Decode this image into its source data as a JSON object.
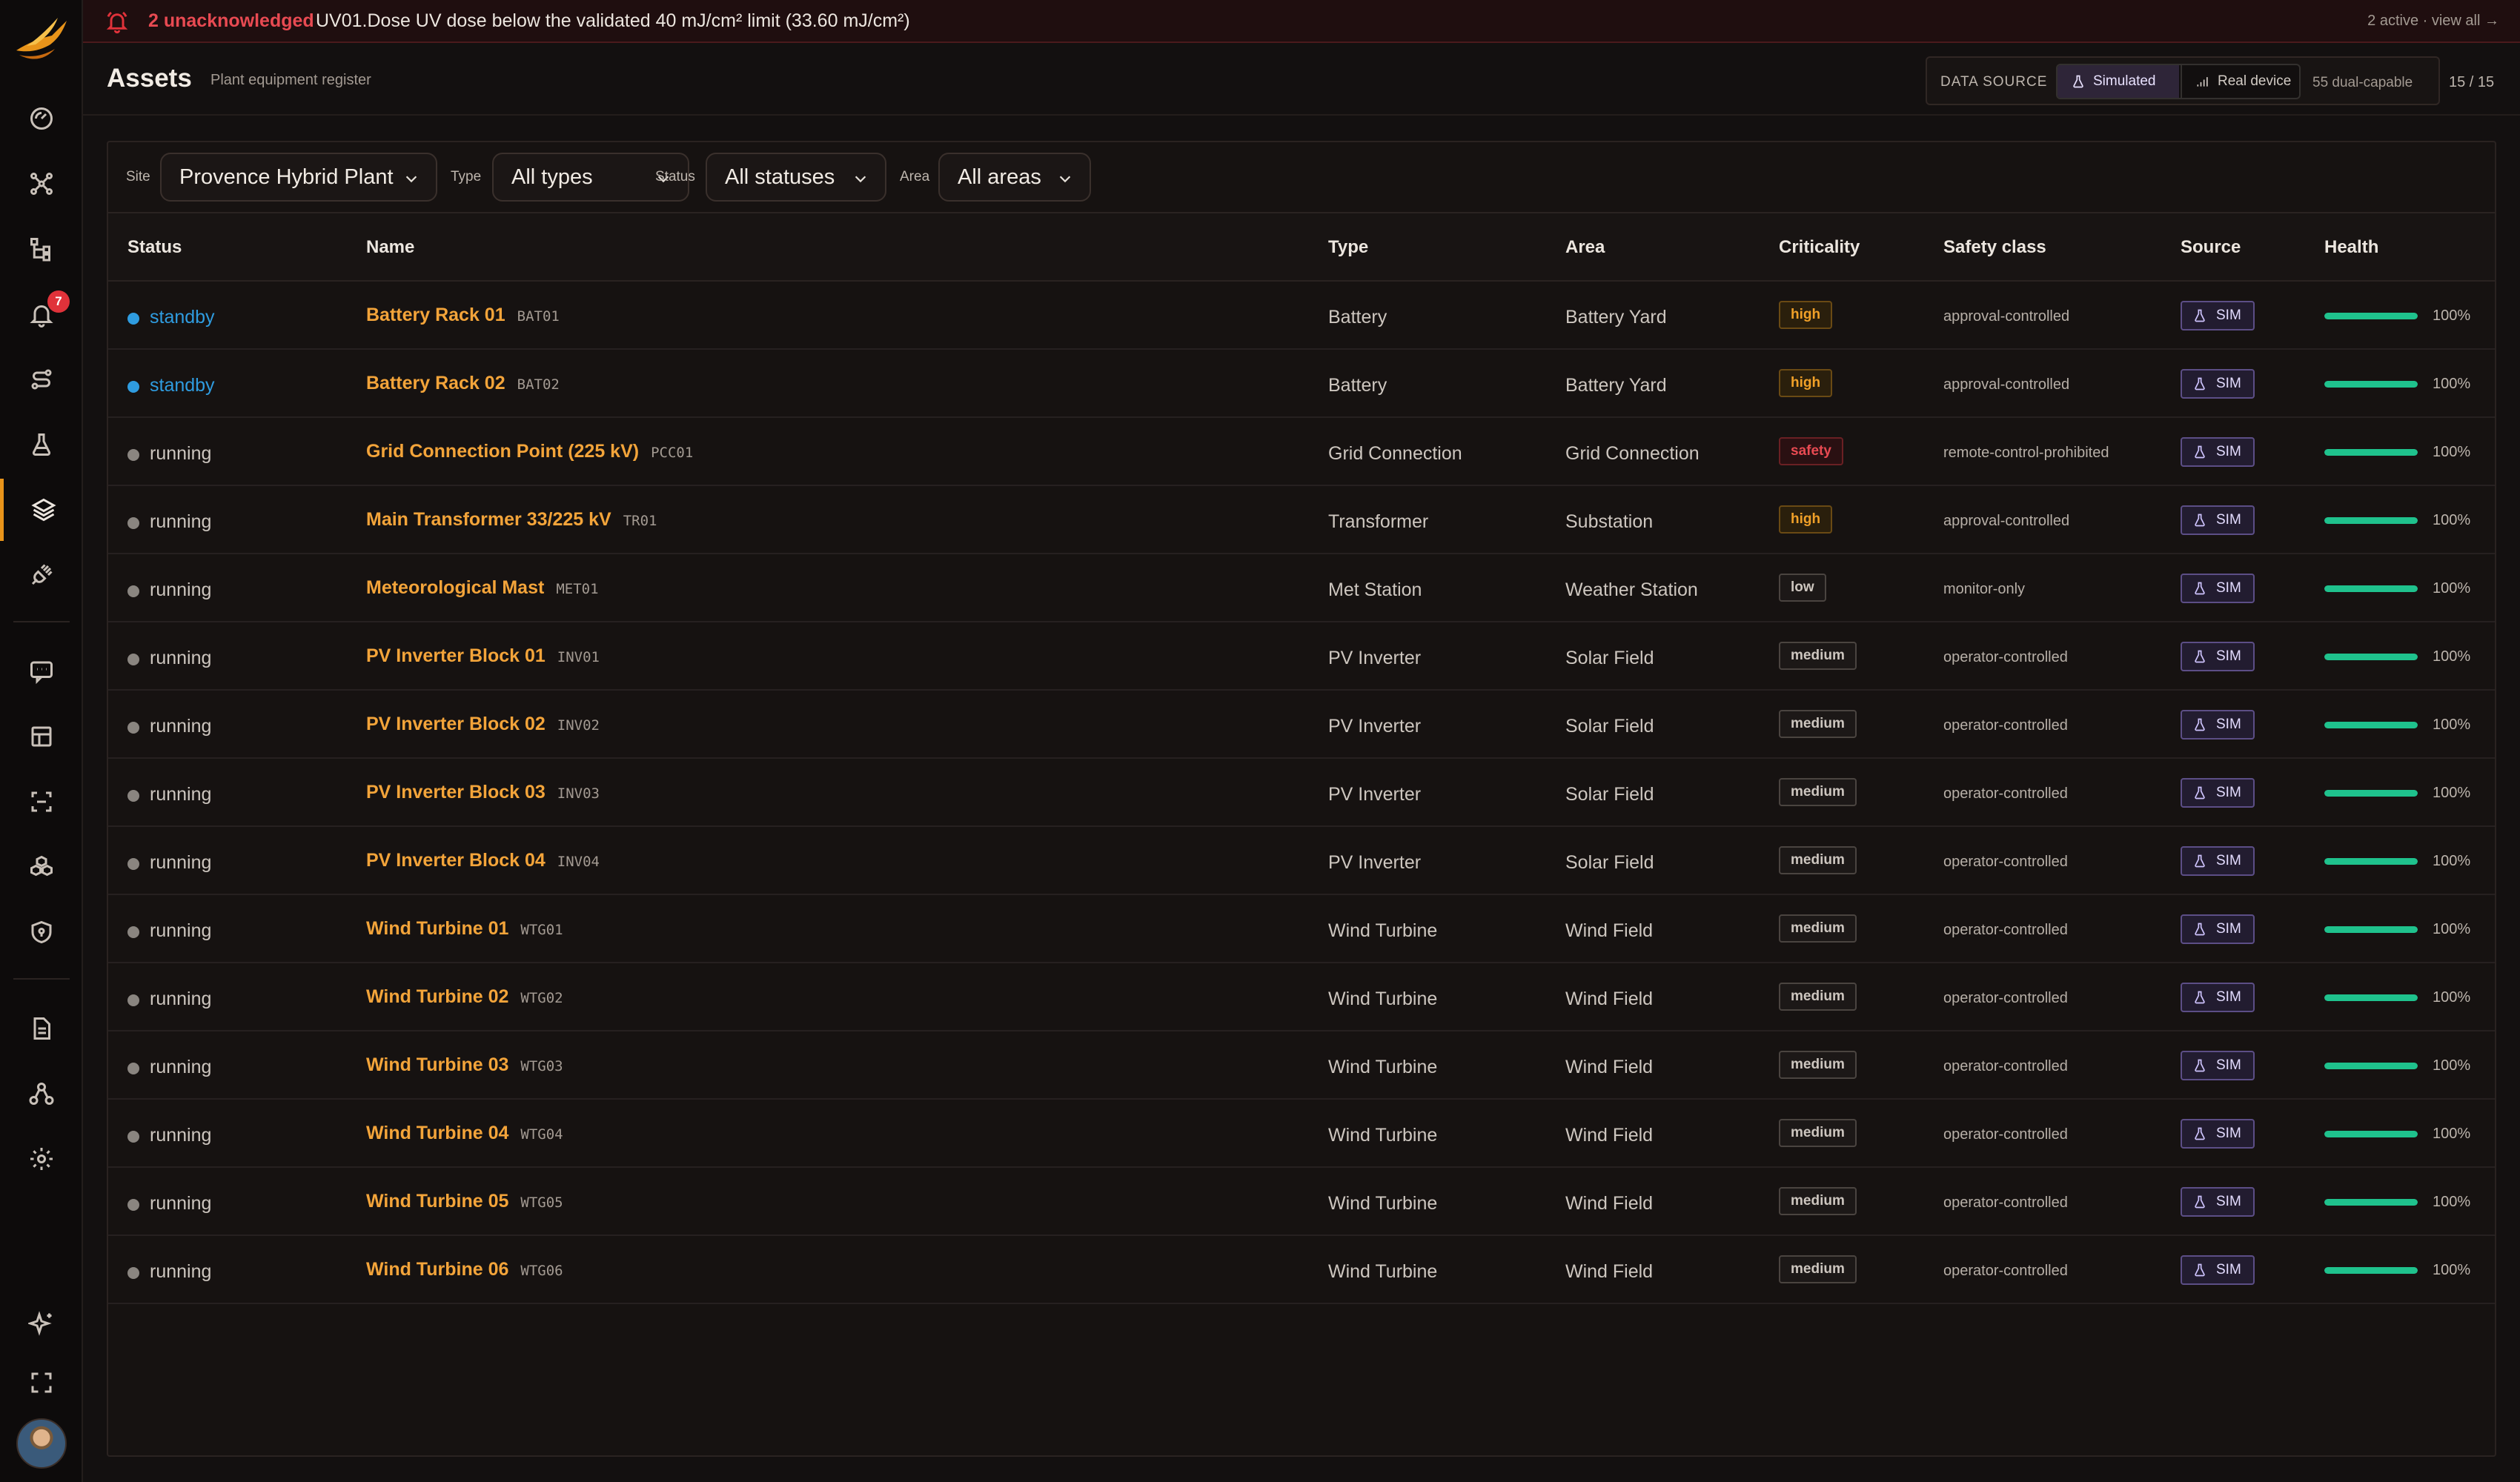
{
  "colors": {
    "accent": "#f3a43a",
    "alert": "#e84a52",
    "standby": "#2f9ce0",
    "running": "#8a8580",
    "health": "#1fc28d",
    "crit_high": "#f0a028",
    "crit_safety": "#e84a52"
  },
  "sidebar": {
    "badge": "7",
    "icons": [
      "dashboard-icon",
      "network-icon",
      "hierarchy-icon",
      "bell-icon",
      "route-icon",
      "flask-icon",
      "layers-icon",
      "plug-icon",
      "chat-icon",
      "grid-icon",
      "scan-icon",
      "boxes-icon",
      "shield-icon",
      "document-icon",
      "org-icon",
      "gear-icon",
      "sparkle-icon",
      "fullscreen-icon"
    ]
  },
  "alert": {
    "count": "2 unacknowledged",
    "message": "UV01.Dose UV dose below the validated 40 mJ/cm² limit (33.60 mJ/cm²)",
    "right": "2 active · view all →"
  },
  "header": {
    "title": "Assets",
    "subtitle": "Plant equipment register",
    "data_source_label": "DATA SOURCE",
    "simulated": "Simulated",
    "real_device": "Real device",
    "dual": "55 dual-capable",
    "count": "15 / 15"
  },
  "filters": {
    "site_label": "Site",
    "site_value": "Provence Hybrid Plant",
    "type_label": "Type",
    "type_value": "All types",
    "status_label": "Status",
    "status_value": "All statuses",
    "area_label": "Area",
    "area_value": "All areas"
  },
  "table": {
    "columns": [
      "Status",
      "Name",
      "Type",
      "Area",
      "Criticality",
      "Safety class",
      "Source",
      "Health"
    ],
    "rows": [
      {
        "status": "standby",
        "name": "Battery Rack 01",
        "code": "BAT01",
        "type": "Battery",
        "area": "Battery Yard",
        "criticality": "high",
        "safety": "approval-controlled",
        "source": "SIM",
        "health": "100%",
        "health_pct": 100
      },
      {
        "status": "standby",
        "name": "Battery Rack 02",
        "code": "BAT02",
        "type": "Battery",
        "area": "Battery Yard",
        "criticality": "high",
        "safety": "approval-controlled",
        "source": "SIM",
        "health": "100%",
        "health_pct": 100
      },
      {
        "status": "running",
        "name": "Grid Connection Point (225 kV)",
        "code": "PCC01",
        "type": "Grid Connection",
        "area": "Grid Connection",
        "criticality": "safety",
        "safety": "remote-control-prohibited",
        "source": "SIM",
        "health": "100%",
        "health_pct": 100
      },
      {
        "status": "running",
        "name": "Main Transformer 33/225 kV",
        "code": "TR01",
        "type": "Transformer",
        "area": "Substation",
        "criticality": "high",
        "safety": "approval-controlled",
        "source": "SIM",
        "health": "100%",
        "health_pct": 100
      },
      {
        "status": "running",
        "name": "Meteorological Mast",
        "code": "MET01",
        "type": "Met Station",
        "area": "Weather Station",
        "criticality": "low",
        "safety": "monitor-only",
        "source": "SIM",
        "health": "100%",
        "health_pct": 100
      },
      {
        "status": "running",
        "name": "PV Inverter Block 01",
        "code": "INV01",
        "type": "PV Inverter",
        "area": "Solar Field",
        "criticality": "medium",
        "safety": "operator-controlled",
        "source": "SIM",
        "health": "100%",
        "health_pct": 100
      },
      {
        "status": "running",
        "name": "PV Inverter Block 02",
        "code": "INV02",
        "type": "PV Inverter",
        "area": "Solar Field",
        "criticality": "medium",
        "safety": "operator-controlled",
        "source": "SIM",
        "health": "100%",
        "health_pct": 100
      },
      {
        "status": "running",
        "name": "PV Inverter Block 03",
        "code": "INV03",
        "type": "PV Inverter",
        "area": "Solar Field",
        "criticality": "medium",
        "safety": "operator-controlled",
        "source": "SIM",
        "health": "100%",
        "health_pct": 100
      },
      {
        "status": "running",
        "name": "PV Inverter Block 04",
        "code": "INV04",
        "type": "PV Inverter",
        "area": "Solar Field",
        "criticality": "medium",
        "safety": "operator-controlled",
        "source": "SIM",
        "health": "100%",
        "health_pct": 100
      },
      {
        "status": "running",
        "name": "Wind Turbine 01",
        "code": "WTG01",
        "type": "Wind Turbine",
        "area": "Wind Field",
        "criticality": "medium",
        "safety": "operator-controlled",
        "source": "SIM",
        "health": "100%",
        "health_pct": 100
      },
      {
        "status": "running",
        "name": "Wind Turbine 02",
        "code": "WTG02",
        "type": "Wind Turbine",
        "area": "Wind Field",
        "criticality": "medium",
        "safety": "operator-controlled",
        "source": "SIM",
        "health": "100%",
        "health_pct": 100
      },
      {
        "status": "running",
        "name": "Wind Turbine 03",
        "code": "WTG03",
        "type": "Wind Turbine",
        "area": "Wind Field",
        "criticality": "medium",
        "safety": "operator-controlled",
        "source": "SIM",
        "health": "100%",
        "health_pct": 100
      },
      {
        "status": "running",
        "name": "Wind Turbine 04",
        "code": "WTG04",
        "type": "Wind Turbine",
        "area": "Wind Field",
        "criticality": "medium",
        "safety": "operator-controlled",
        "source": "SIM",
        "health": "100%",
        "health_pct": 100
      },
      {
        "status": "running",
        "name": "Wind Turbine 05",
        "code": "WTG05",
        "type": "Wind Turbine",
        "area": "Wind Field",
        "criticality": "medium",
        "safety": "operator-controlled",
        "source": "SIM",
        "health": "100%",
        "health_pct": 100
      },
      {
        "status": "running",
        "name": "Wind Turbine 06",
        "code": "WTG06",
        "type": "Wind Turbine",
        "area": "Wind Field",
        "criticality": "medium",
        "safety": "operator-controlled",
        "source": "SIM",
        "health": "100%",
        "health_pct": 100
      }
    ]
  }
}
